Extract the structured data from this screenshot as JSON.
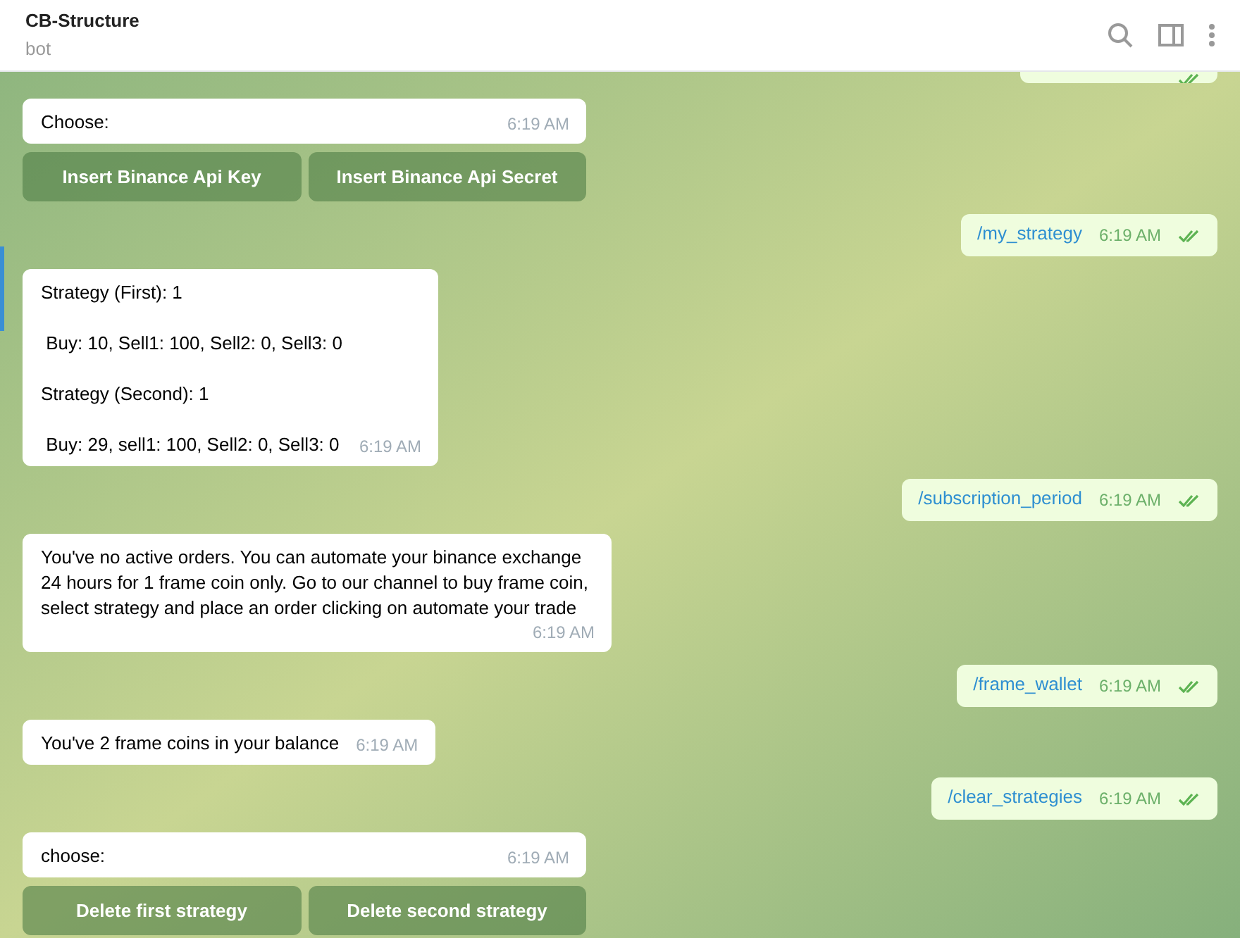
{
  "header": {
    "title": "CB-Structure",
    "subtitle": "bot"
  },
  "messages": [
    {
      "kind": "partial_out",
      "read": true
    },
    {
      "kind": "in",
      "text": "Choose:",
      "time": "6:19 AM",
      "buttons": [
        "Insert Binance Api Key",
        "Insert Binance Api Secret"
      ]
    },
    {
      "kind": "out",
      "text": "/my_strategy",
      "time": "6:19 AM",
      "read": true
    },
    {
      "kind": "in",
      "text": "Strategy (First): 1\n\n Buy: 10, Sell1: 100, Sell2: 0, Sell3: 0\n\nStrategy (Second): 1\n\n Buy: 29, sell1: 100, Sell2: 0, Sell3: 0",
      "time": "6:19 AM"
    },
    {
      "kind": "out",
      "text": "/subscription_period",
      "time": "6:19 AM",
      "read": true
    },
    {
      "kind": "in",
      "text": "You've no active orders. You can automate your binance exchange 24 hours for 1 frame coin only. Go to our channel to buy frame coin, select strategy and place an order clicking on automate your trade",
      "time": "6:19 AM"
    },
    {
      "kind": "out",
      "text": "/frame_wallet",
      "time": "6:19 AM",
      "read": true
    },
    {
      "kind": "in",
      "text": "You've 2 frame coins in your balance",
      "time": "6:19 AM"
    },
    {
      "kind": "out",
      "text": "/clear_strategies",
      "time": "6:19 AM",
      "read": true
    },
    {
      "kind": "in",
      "text": "choose:",
      "time": "6:19 AM",
      "buttons": [
        "Delete first strategy",
        "Delete second strategy"
      ]
    }
  ]
}
